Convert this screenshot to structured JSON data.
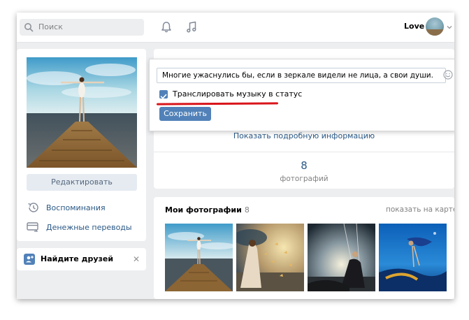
{
  "header": {
    "search_placeholder": "Поиск",
    "user_name": "Love",
    "icons": [
      "search-icon",
      "bell-icon",
      "music-icon",
      "chevron-down-icon"
    ]
  },
  "left": {
    "edit_label": "Редактировать",
    "links": [
      {
        "label": "Воспоминания",
        "icon": "history-icon"
      },
      {
        "label": "Денежные переводы",
        "icon": "money-transfer-icon"
      }
    ],
    "find_friends": "Найдите друзей"
  },
  "status_editor": {
    "value": "Многие ужаснулись бы, если в зеркале видели не лица, а свои души.",
    "broadcast_label": "Транслировать музыку в статус",
    "broadcast_checked": true,
    "save_label": "Сохранить"
  },
  "info": {
    "show_details": "Показать подробную информацию",
    "photos_count": "8",
    "photos_count_label": "фотографий"
  },
  "photos": {
    "title": "Мои фотографии",
    "count": "8",
    "map_link": "показать на карте"
  },
  "colors": {
    "accent": "#5181b8",
    "link": "#2a5885",
    "highlight_underline": "#d9151b",
    "page_bg": "#edeef0"
  }
}
